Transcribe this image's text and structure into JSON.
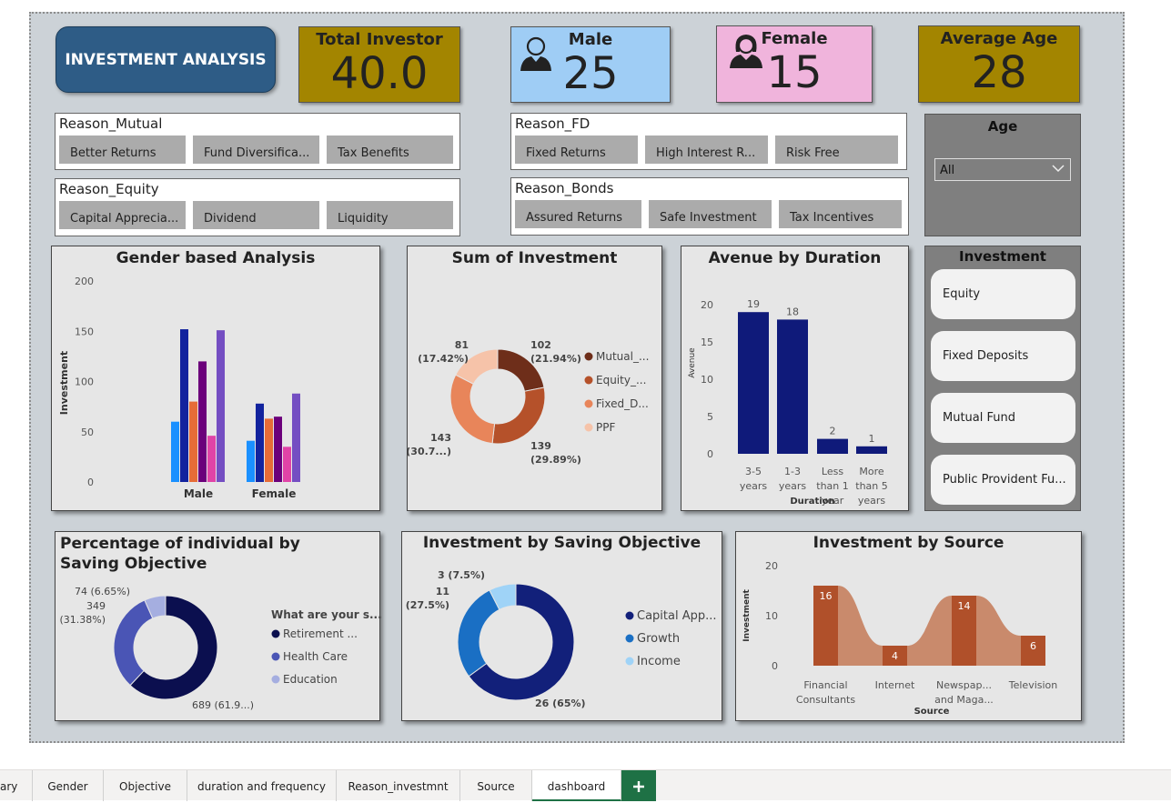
{
  "header": {
    "title": "INVESTMENT ANALYSIS"
  },
  "kpis": {
    "total": {
      "label": "Total Investor",
      "value": "40.0"
    },
    "male": {
      "label": "Male",
      "value": "25"
    },
    "female": {
      "label": "Female",
      "value": "15"
    },
    "age": {
      "label": "Average Age",
      "value": "28"
    }
  },
  "slicers": {
    "mutual": {
      "title": "Reason_Mutual",
      "items": [
        "Better Returns",
        "Fund Diversifica...",
        "Tax Benefits"
      ]
    },
    "equity": {
      "title": "Reason_Equity",
      "items": [
        "Capital Apprecia...",
        "Dividend",
        "Liquidity"
      ]
    },
    "fd": {
      "title": "Reason_FD",
      "items": [
        "Fixed Returns",
        "High Interest R...",
        "Risk Free"
      ]
    },
    "bonds": {
      "title": "Reason_Bonds",
      "items": [
        "Assured Returns",
        "Safe Investment",
        "Tax Incentives"
      ]
    },
    "age": {
      "title": "Age",
      "selected": "All"
    },
    "investment": {
      "title": "Investment",
      "items": [
        "Equity",
        "Fixed Deposits",
        "Mutual Fund",
        "Public Provident Fu..."
      ]
    }
  },
  "charts": {
    "gender": {
      "title": "Gender based Analysis"
    },
    "sum": {
      "title": "Sum of Investment"
    },
    "duration": {
      "title": "Avenue by Duration"
    },
    "pct": {
      "title": "Percentage of individual by Saving Objective"
    },
    "objective": {
      "title": "Investment by Saving Objective"
    },
    "source": {
      "title": "Investment by Source"
    }
  },
  "colors": {
    "kpi_gold": "#a38500",
    "kpi_blue": "#9fcdf5",
    "kpi_pink": "#f0b4dc",
    "title_blue": "#2e5c86",
    "navy": "#0f1a7a",
    "rust": "#b5512a"
  },
  "icons": {
    "male": "male-avatar-icon",
    "female": "female-avatar-icon",
    "age_dropdown": "chevron-down-icon",
    "add_sheet": "plus-icon"
  },
  "chart_data": [
    {
      "type": "bar",
      "title": "Gender based Analysis",
      "ylabel": "Investment",
      "ylim": [
        0,
        200
      ],
      "yticks": [
        "0",
        "50",
        "100",
        "150",
        "200"
      ],
      "categories": [
        "Male",
        "Female"
      ],
      "series": [
        {
          "color": "#1a90ff",
          "values": [
            60,
            41
          ]
        },
        {
          "color": "#12239e",
          "values": [
            152,
            78
          ]
        },
        {
          "color": "#e66c37",
          "values": [
            80,
            63
          ]
        },
        {
          "color": "#6b007b",
          "values": [
            120,
            65
          ]
        },
        {
          "color": "#e044a7",
          "values": [
            46,
            35
          ]
        },
        {
          "color": "#744ec2",
          "values": [
            151,
            88
          ]
        }
      ]
    },
    {
      "type": "pie",
      "title": "Sum of Investment",
      "legend": [
        "Mutual_...",
        "Equity_...",
        "Fixed_D...",
        "PPF"
      ],
      "values": [
        102,
        139,
        143,
        81
      ],
      "colors": [
        "#6e2e1a",
        "#b5512a",
        "#e8855a",
        "#f6c3a9"
      ],
      "labels": [
        [
          "102",
          "(21.94%)"
        ],
        [
          "139",
          "(29.89%)"
        ],
        [
          "143",
          "(30.7...)"
        ],
        [
          "81",
          "(17.42%)"
        ]
      ]
    },
    {
      "type": "bar",
      "title": "Avenue by Duration",
      "xlabel": "Duration",
      "ylabel": "Avenue",
      "ylim": [
        0,
        20
      ],
      "yticks": [
        "0",
        "5",
        "10",
        "15",
        "20"
      ],
      "categories": [
        [
          "3-5",
          "years"
        ],
        [
          "1-3",
          "years"
        ],
        [
          "Less",
          "than 1",
          "year"
        ],
        [
          "More",
          "than 5",
          "years"
        ]
      ],
      "values": [
        19,
        18,
        2,
        1
      ],
      "color": "#0f1a7a"
    },
    {
      "type": "pie",
      "title": "Percentage of individual by Saving Objective",
      "legend_title": "What are your s...",
      "legend": [
        "Retirement ...",
        "Health Care",
        "Education"
      ],
      "values": [
        689,
        349,
        74
      ],
      "colors": [
        "#0b0f4f",
        "#4a55b5",
        "#a5aee0"
      ],
      "labels": [
        [
          "689 (61.9...)"
        ],
        [
          "349",
          "(31.38%)"
        ],
        [
          "74 (6.65%)"
        ]
      ]
    },
    {
      "type": "pie",
      "title": "Investment by Saving Objective",
      "legend": [
        "Capital App...",
        "Growth",
        "Income"
      ],
      "values": [
        26,
        11,
        3
      ],
      "colors": [
        "#12207a",
        "#1a6fc4",
        "#9fd3f7"
      ],
      "labels": [
        [
          "26 (65%)"
        ],
        [
          "11",
          "(27.5%)"
        ],
        [
          "3 (7.5%)"
        ]
      ]
    },
    {
      "type": "bar",
      "title": "Investment by Source",
      "xlabel": "Source",
      "ylabel": "Investment",
      "ylim": [
        0,
        20
      ],
      "yticks": [
        "0",
        "10",
        "20"
      ],
      "categories": [
        [
          "Financial",
          "Consultants"
        ],
        [
          "Internet"
        ],
        [
          "Newspap...",
          "and Maga..."
        ],
        [
          "Television"
        ]
      ],
      "values": [
        16,
        4,
        14,
        6
      ],
      "color": "#b0502a",
      "ribbon_color": "#c98a6c"
    }
  ],
  "tabs": {
    "items": [
      "ary",
      "Gender",
      "Objective",
      "duration and frequency",
      "Reason_investmnt",
      "Source",
      "dashboard"
    ],
    "active": "dashboard"
  }
}
